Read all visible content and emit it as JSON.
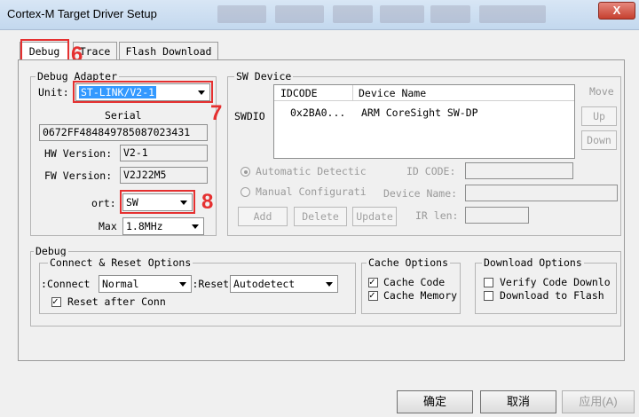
{
  "window": {
    "title": "Cortex-M Target Driver Setup",
    "close_label": "X"
  },
  "tabs": [
    "Debug",
    "Trace",
    "Flash Download"
  ],
  "debug_adapter": {
    "group_label": "Debug Adapter",
    "unit_label": "Unit:",
    "unit_value": "ST-LINK/V2-1",
    "serial_label": "Serial",
    "serial_value": "0672FF484849785087023431",
    "hw_label": "HW Version:",
    "hw_value": "V2-1",
    "fw_label": "FW Version:",
    "fw_value": "V2J22M5",
    "port_label": "ort:",
    "port_value": "SW",
    "max_label": "Max",
    "max_value": "1.8MHz"
  },
  "sw_device": {
    "group_label": "SW Device",
    "swdio_label": "SWDIO",
    "columns": [
      "IDCODE",
      "Device Name"
    ],
    "rows": [
      {
        "idcode": "0x2BA0...",
        "name": "ARM CoreSight SW-DP"
      }
    ],
    "move_label": "Move",
    "up_label": "Up",
    "down_label": "Down",
    "auto_label": "Automatic Detectic",
    "manual_label": "Manual Configurati",
    "id_code_label": "ID CODE:",
    "device_name_label": "Device Name:",
    "ir_len_label": "IR len:",
    "add_label": "Add",
    "delete_label": "Delete",
    "update_label": "Update"
  },
  "debug": {
    "group_label": "Debug",
    "connect_reset": {
      "group_label": "Connect & Reset Options",
      "connect_label": "Connect:",
      "connect_value": "Normal",
      "reset_label": "Reset:",
      "reset_value": "Autodetect",
      "reset_after_label": "Reset after Conn",
      "reset_after_checked": true
    },
    "cache": {
      "group_label": "Cache Options",
      "cache_code_label": "Cache Code",
      "cache_code_checked": true,
      "cache_memory_label": "Cache Memory",
      "cache_memory_checked": true
    },
    "download": {
      "group_label": "Download Options",
      "verify_label": "Verify Code Downlo",
      "verify_checked": false,
      "flash_label": "Download to Flash",
      "flash_checked": false
    }
  },
  "annotations": {
    "n6": "6",
    "n7": "7",
    "n8": "8"
  },
  "buttons": {
    "ok": "确定",
    "cancel": "取消",
    "apply": "应用(A)"
  },
  "colors": {
    "annotation": "#e53030",
    "selection": "#3399ff"
  }
}
